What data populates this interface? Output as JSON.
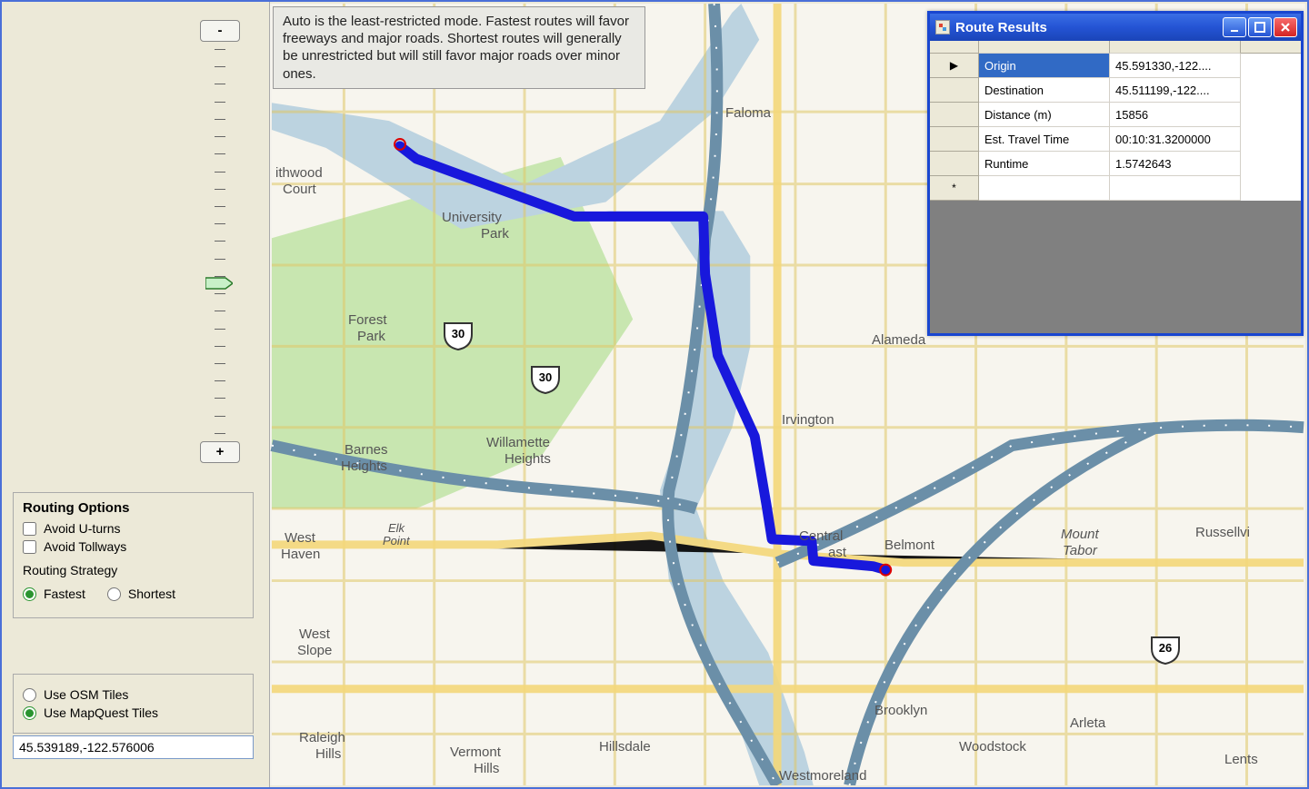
{
  "sidebar": {
    "zoom_minus": "-",
    "zoom_plus": "+",
    "routing_heading": "Routing Options",
    "avoid_uturns": "Avoid U-turns",
    "avoid_tollways": "Avoid Tollways",
    "strategy_label": "Routing Strategy",
    "strategy_fastest": "Fastest",
    "strategy_shortest": "Shortest",
    "tile_osm": "Use OSM Tiles",
    "tile_mapquest": "Use MapQuest Tiles",
    "coord_value": "45.539189,-122.576006"
  },
  "info_tip": "Auto is the least-restricted mode. Fastest routes will favor freeways and major roads. Shortest routes will generally be unrestricted but will still favor major roads over minor ones.",
  "map_labels": {
    "faloma": "Faloma",
    "ithwood": "ithwood",
    "court": "Court",
    "univ_park": "University",
    "univ_park2": "Park",
    "forest_park": "Forest",
    "forest_park2": "Park",
    "willamette": "Willamette",
    "heights": "Heights",
    "barnes": "Barnes",
    "barnes2": "Heights",
    "elk_point": "Elk",
    "elk_point2": "Point",
    "west_haven": "West",
    "west_haven2": "Haven",
    "west_slope": "West",
    "west_slope2": "Slope",
    "raleigh": "Raleigh",
    "raleigh2": "Hills",
    "vermont": "Vermont",
    "vermont2": "Hills",
    "hillsdale": "Hillsdale",
    "westmoreland": "Westmoreland",
    "brooklyn": "Brooklyn",
    "woodstock": "Woodstock",
    "arleta": "Arleta",
    "lents": "Lents",
    "russellvi": "Russellvi",
    "mount_tabor": "Mount",
    "mount_tabor2": "Tabor",
    "belmont": "Belmont",
    "central_east": "Central",
    "central_east2": "ast",
    "irvington": "Irvington",
    "alameda": "Alameda",
    "shield_30a": "30",
    "shield_30b": "30",
    "shield_26": "26"
  },
  "results": {
    "title": "Route Results",
    "rows": [
      {
        "key": "Origin",
        "value": "45.591330,-122...."
      },
      {
        "key": "Destination",
        "value": "45.511199,-122...."
      },
      {
        "key": "Distance (m)",
        "value": "15856"
      },
      {
        "key": "Est. Travel Time",
        "value": "00:10:31.3200000"
      },
      {
        "key": "Runtime",
        "value": "1.5742643"
      }
    ],
    "new_row_marker": "*"
  }
}
